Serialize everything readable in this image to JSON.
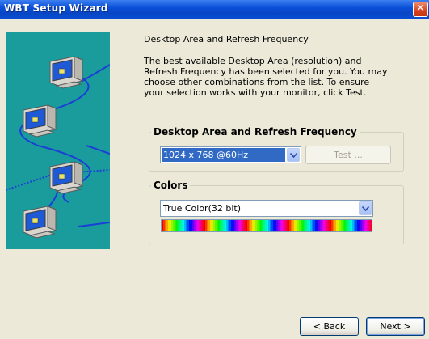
{
  "window": {
    "title": "WBT Setup Wizard",
    "close_glyph": "✕"
  },
  "intro": {
    "heading": "Desktop Area and Refresh Frequency",
    "description": "The best available Desktop Area (resolution) and\nRefresh Frequency has been selected for you.  You may\nchoose other combinations from the list.  To ensure\nyour selection works with your monitor, click Test."
  },
  "resolution_group": {
    "legend": "Desktop Area and Refresh Frequency",
    "selected": "1024 x 768 @60Hz",
    "test_label": "Test ..."
  },
  "colors_group": {
    "legend": "Colors",
    "selected": "True Color(32 bit)"
  },
  "footer": {
    "back_label": "< Back",
    "next_label": "Next >"
  },
  "icons": {
    "close": "close-icon",
    "dropdown": "chevron-down-icon",
    "monitor": "monitor-icon"
  },
  "colors": {
    "title_bar": "#0a4fd8",
    "side_panel": "#1b9c9c",
    "selection": "#316ac5",
    "network_line": "#1a3fd6"
  }
}
